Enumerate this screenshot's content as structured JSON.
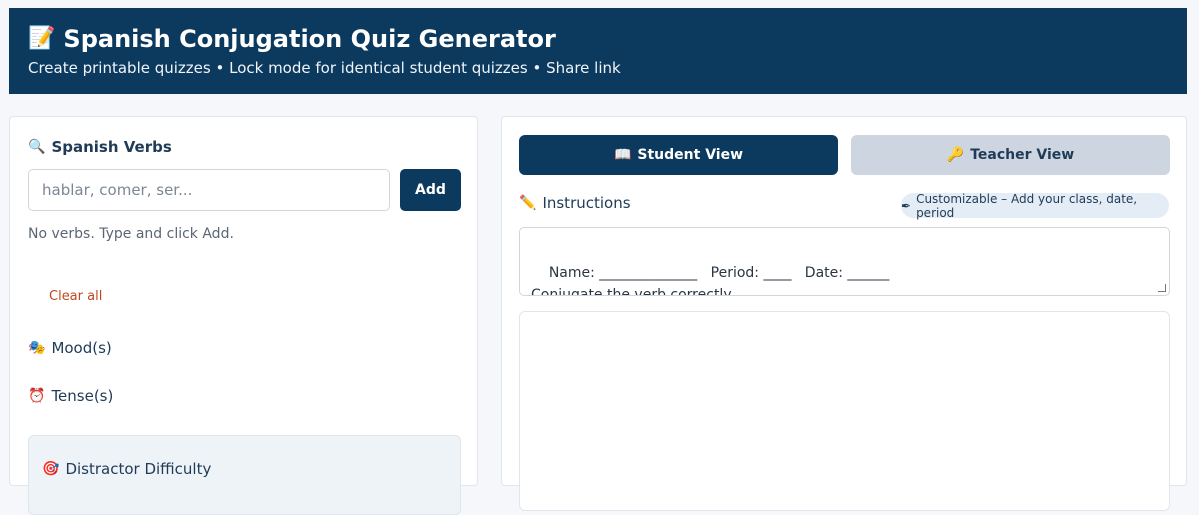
{
  "header": {
    "title_icon": "memo-icon",
    "title": "Spanish Conjugation Quiz Generator",
    "subtitle": "Create printable quizzes • Lock mode for identical student quizzes • Share link"
  },
  "left_panel": {
    "verbs_title": "Spanish Verbs",
    "verbs_icon": "magnifier-icon",
    "input_placeholder": "hablar, comer, ser...",
    "input_value": "",
    "add_label": "Add",
    "empty_hint": "No verbs. Type and click Add.",
    "clear_label": "Clear all",
    "mood_title": "Mood(s)",
    "mood_icon": "theater-masks-icon",
    "tense_title": "Tense(s)",
    "tense_icon": "alarm-clock-icon",
    "difficulty_title": "Distractor Difficulty",
    "difficulty_icon": "target-icon"
  },
  "right_panel": {
    "student_view_label": "Student View",
    "student_view_icon": "book-icon",
    "teacher_view_label": "Teacher View",
    "teacher_view_icon": "key-icon",
    "instructions_title": "Instructions",
    "instructions_icon": "pencil-icon",
    "customizable_badge": "Customizable – Add your class, date, period",
    "customizable_icon": "pen-icon",
    "instructions_text": "Name: ______________   Period: ____   Date: ______\nConjugate the verb correctly."
  },
  "colors": {
    "primary": "#0c3a5f",
    "secondary_button": "#ccd5e0",
    "link": "#c0471b",
    "background": "#f5f7fa"
  }
}
